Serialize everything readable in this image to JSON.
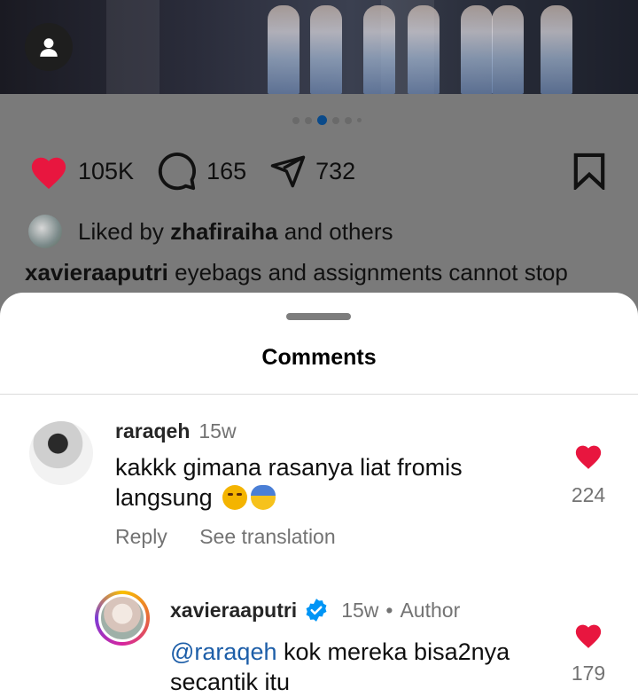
{
  "post": {
    "stats": {
      "likes": "105K",
      "comments": "165",
      "shares": "732"
    },
    "liked_by": {
      "prefix": "Liked by",
      "user": "zhafiraiha",
      "suffix": "and others"
    },
    "caption": {
      "user": "xavieraaputri",
      "text": "eyebags and assignments cannot stop"
    }
  },
  "comments_sheet": {
    "title": "Comments",
    "comments": [
      {
        "user": "raraqeh",
        "time": "15w",
        "text": "kakkk gimana rasanya liat fromis langsung",
        "likes": "224",
        "reply_label": "Reply",
        "translate_label": "See translation"
      }
    ],
    "reply": {
      "user": "xavieraaputri",
      "time": "15w",
      "separator": "•",
      "badge": "Author",
      "mention": "@raraqeh",
      "text": "kok mereka bisa2nya secantik itu",
      "likes": "179"
    }
  },
  "colors": {
    "heart": "#e8163f",
    "link": "#1d5ea8",
    "verified": "#0095f6",
    "secondary_text": "#737373"
  },
  "icons": [
    "user-icon",
    "heart-icon",
    "comment-icon",
    "share-icon",
    "bookmark-icon",
    "verified-icon"
  ]
}
